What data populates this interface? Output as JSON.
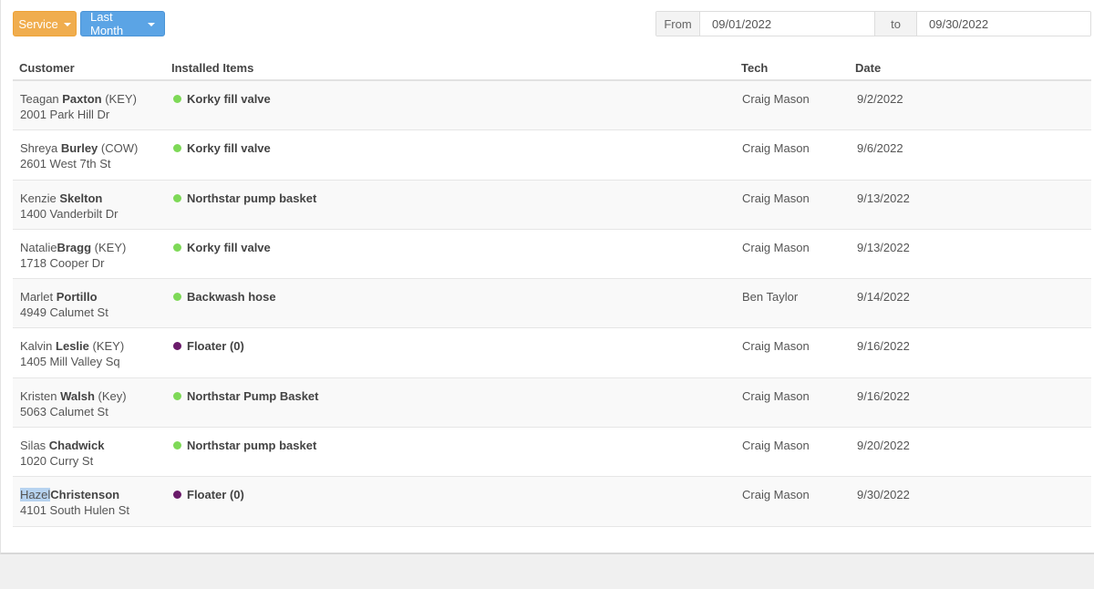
{
  "toolbar": {
    "service_label": "Service",
    "month_label": "Last Month"
  },
  "date_range": {
    "from_label": "From",
    "from_value": "09/01/2022",
    "to_label": "to",
    "to_value": "09/30/2022"
  },
  "columns": {
    "customer": "Customer",
    "items": "Installed Items",
    "tech": "Tech",
    "date": "Date"
  },
  "colors": {
    "installed": "#7ed957",
    "floater": "#6a1b6a"
  },
  "rows": [
    {
      "first": "Teagan ",
      "last": "Paxton",
      "tag": " (KEY)",
      "address": "2001 Park Hill Dr",
      "item": "Korky fill valve",
      "dot": "green",
      "tech": "Craig Mason",
      "date": "9/2/2022"
    },
    {
      "first": "Shreya ",
      "last": "Burley",
      "tag": " (COW)",
      "address": "2601 West 7th St",
      "item": "Korky fill valve",
      "dot": "green",
      "tech": "Craig Mason",
      "date": "9/6/2022"
    },
    {
      "first": "Kenzie ",
      "last": "Skelton",
      "tag": "",
      "address": "1400 Vanderbilt Dr",
      "item": "Northstar pump basket",
      "dot": "green",
      "tech": "Craig Mason",
      "date": "9/13/2022"
    },
    {
      "first": "Natalie",
      "last": "Bragg",
      "tag": " (KEY)",
      "address": "1718 Cooper Dr",
      "item": "Korky fill valve",
      "dot": "green",
      "tech": "Craig Mason",
      "date": "9/13/2022"
    },
    {
      "first": "Marlet ",
      "last": "Portillo",
      "tag": "",
      "address": "4949 Calumet St",
      "item": "Backwash hose",
      "dot": "green",
      "tech": "Ben Taylor",
      "date": "9/14/2022"
    },
    {
      "first": "Kalvin ",
      "last": "Leslie",
      "tag": " (KEY)",
      "address": "1405 Mill Valley Sq",
      "item": "Floater (0)",
      "dot": "purple",
      "tech": "Craig Mason",
      "date": "9/16/2022"
    },
    {
      "first": "Kristen ",
      "last": "Walsh",
      "tag": " (Key)",
      "address": "5063 Calumet St",
      "item": "Northstar Pump Basket",
      "dot": "green",
      "tech": "Craig Mason",
      "date": "9/16/2022"
    },
    {
      "first": "Silas ",
      "last": "Chadwick",
      "tag": "",
      "address": "1020 Curry St",
      "item": "Northstar pump basket",
      "dot": "green",
      "tech": "Craig Mason",
      "date": "9/20/2022"
    },
    {
      "first": "Hazel",
      "last": "Christenson",
      "tag": "",
      "address": "4101 South Hulen St",
      "item": "Floater (0)",
      "dot": "purple",
      "tech": "Craig Mason",
      "date": "9/30/2022",
      "selected": true
    }
  ]
}
